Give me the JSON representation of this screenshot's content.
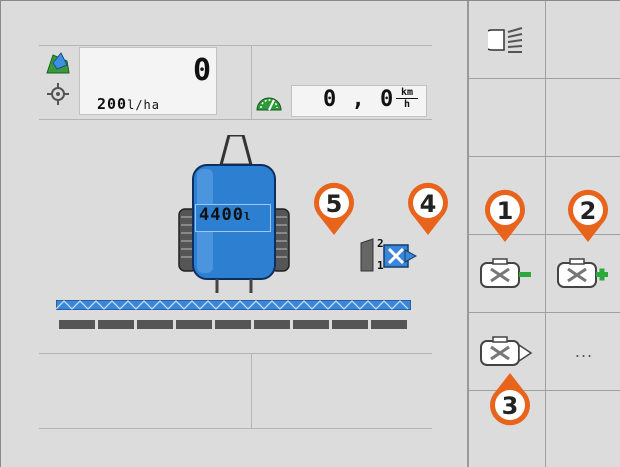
{
  "colors": {
    "background": "#dcdcdc",
    "tank_blue": "#2d7fd2",
    "marker_orange": "#e8641c",
    "section_bar": "#555555",
    "boom_blue": "#3a86d8"
  },
  "status": {
    "applied_value": "0",
    "rate_value": "200",
    "rate_unit": "l/ha",
    "speed_value": "0 , 0",
    "speed_unit_top": "km",
    "speed_unit_bottom": "h"
  },
  "tank": {
    "volume": "4400",
    "unit": "l"
  },
  "section_indicator": {
    "top_number": "2",
    "bottom_number": "1"
  },
  "markers": [
    "5",
    "4",
    "1",
    "2",
    "3"
  ],
  "sidebar": {
    "more_label": "..."
  },
  "icons": {
    "field_area": "field-area-icon",
    "target_rate": "target-icon",
    "speedometer": "speedometer-icon",
    "lights": "work-lights-icon",
    "nozzle_minus": "nozzle-minus-icon",
    "nozzle_plus": "nozzle-plus-icon",
    "nozzle_next": "nozzle-next-icon",
    "section_switch": "section-switch-icon"
  }
}
